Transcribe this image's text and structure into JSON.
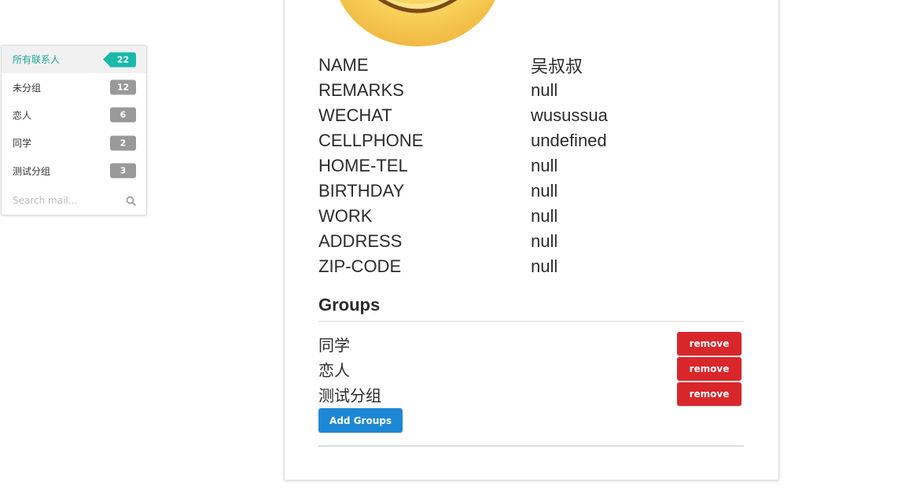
{
  "sidebar": {
    "items": [
      {
        "label": "所有联系人",
        "count": "22",
        "active": true
      },
      {
        "label": "未分组",
        "count": "12"
      },
      {
        "label": "恋人",
        "count": "6"
      },
      {
        "label": "同学",
        "count": "2"
      },
      {
        "label": "测试分组",
        "count": "3"
      }
    ],
    "search_placeholder": "Search mail...",
    "search_icon": "magnifier-icon"
  },
  "contact": {
    "avatar_icon": "smiley-face-icon",
    "fields": [
      {
        "label": "NAME",
        "value": "吴叔叔"
      },
      {
        "label": "REMARKS",
        "value": "null"
      },
      {
        "label": "WECHAT",
        "value": "wusussua"
      },
      {
        "label": "CELLPHONE",
        "value": "undefined"
      },
      {
        "label": "HOME-TEL",
        "value": "null"
      },
      {
        "label": "BIRTHDAY",
        "value": "null"
      },
      {
        "label": "WORK",
        "value": "null"
      },
      {
        "label": "ADDRESS",
        "value": "null"
      },
      {
        "label": "ZIP-CODE",
        "value": "null"
      }
    ]
  },
  "groups": {
    "title": "Groups",
    "items": [
      {
        "name": "同学",
        "remove_label": "remove"
      },
      {
        "name": "恋人",
        "remove_label": "remove"
      },
      {
        "name": "测试分组",
        "remove_label": "remove"
      }
    ],
    "add_label": "Add Groups"
  },
  "colors": {
    "accent": "#19b9aa",
    "badge_gray": "#999999",
    "remove_red": "#d9262b",
    "add_blue": "#1e88d4"
  }
}
